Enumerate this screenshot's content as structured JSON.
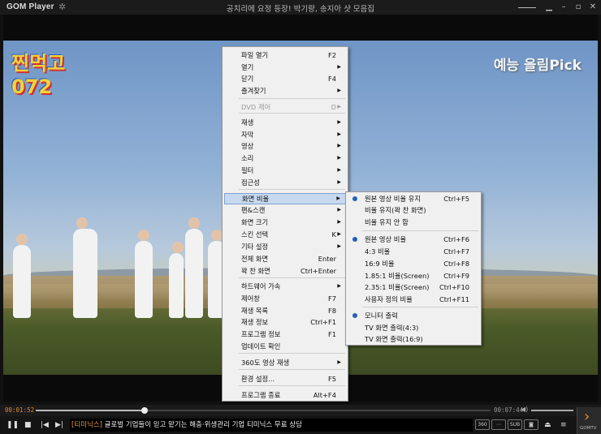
{
  "window": {
    "brand": "GOM Player",
    "title": "공치리에 요정 등장! 박기량, 송지아 샷 모음집"
  },
  "menu": {
    "items": [
      {
        "label": "파일 열기",
        "shortcut": "F2",
        "submenu": false
      },
      {
        "label": "열기",
        "shortcut": "",
        "submenu": true
      },
      {
        "label": "닫기",
        "shortcut": "F4",
        "submenu": false
      },
      {
        "label": "즐겨찾기",
        "shortcut": "",
        "submenu": true
      },
      {
        "label": "DVD 제어",
        "shortcut": "D",
        "submenu": true,
        "disabled": true
      },
      {
        "label": "재생",
        "shortcut": "",
        "submenu": true
      },
      {
        "label": "자막",
        "shortcut": "",
        "submenu": true
      },
      {
        "label": "영상",
        "shortcut": "",
        "submenu": true
      },
      {
        "label": "소리",
        "shortcut": "",
        "submenu": true
      },
      {
        "label": "필터",
        "shortcut": "",
        "submenu": true
      },
      {
        "label": "접근성",
        "shortcut": "",
        "submenu": true
      },
      {
        "label": "화면 비율",
        "shortcut": "",
        "submenu": true,
        "highlighted": true
      },
      {
        "label": "팬&스캔",
        "shortcut": "",
        "submenu": true
      },
      {
        "label": "화면 크기",
        "shortcut": "",
        "submenu": true
      },
      {
        "label": "스킨 선택",
        "shortcut": "K",
        "submenu": true
      },
      {
        "label": "기타 설정",
        "shortcut": "",
        "submenu": true
      },
      {
        "label": "전체 화면",
        "shortcut": "Enter",
        "submenu": false
      },
      {
        "label": "꽉 찬 화면",
        "shortcut": "Ctrl+Enter",
        "submenu": false
      },
      {
        "label": "하드웨어 가속",
        "shortcut": "",
        "submenu": true
      },
      {
        "label": "제어창",
        "shortcut": "F7",
        "submenu": false
      },
      {
        "label": "재생 목록",
        "shortcut": "F8",
        "submenu": false
      },
      {
        "label": "재생 정보",
        "shortcut": "Ctrl+F1",
        "submenu": false
      },
      {
        "label": "프로그램 정보",
        "shortcut": "F1",
        "submenu": false
      },
      {
        "label": "업데이트 확인",
        "shortcut": "",
        "submenu": false
      },
      {
        "label": "360도 영상 재생",
        "shortcut": "",
        "submenu": true
      },
      {
        "label": "환경 설정...",
        "shortcut": "F5",
        "submenu": false
      },
      {
        "label": "프로그램 종료",
        "shortcut": "Alt+F4",
        "submenu": false
      }
    ]
  },
  "submenu": {
    "items": [
      {
        "label": "원본 영상 비율 유지",
        "shortcut": "Ctrl+F5",
        "checked": true
      },
      {
        "label": "비율 유지(꽉 찬 화면)",
        "shortcut": "",
        "checked": false
      },
      {
        "label": "비율 유지 안 함",
        "shortcut": "",
        "checked": false
      },
      {
        "label": "원본 영상 비율",
        "shortcut": "Ctrl+F6",
        "checked": true
      },
      {
        "label": "4:3 비율",
        "shortcut": "Ctrl+F7",
        "checked": false
      },
      {
        "label": "16:9 비율",
        "shortcut": "Ctrl+F8",
        "checked": false
      },
      {
        "label": "1.85:1 비율(Screen)",
        "shortcut": "Ctrl+F9",
        "checked": false
      },
      {
        "label": "2.35:1 비율(Screen)",
        "shortcut": "Ctrl+F10",
        "checked": false
      },
      {
        "label": "사용자 정의 비율",
        "shortcut": "Ctrl+F11",
        "checked": false
      },
      {
        "label": "모니터 출력",
        "shortcut": "",
        "checked": true
      },
      {
        "label": "TV 화면 출력(4:3)",
        "shortcut": "",
        "checked": false
      },
      {
        "label": "TV 화면 출력(16:9)",
        "shortcut": "",
        "checked": false
      }
    ]
  },
  "player": {
    "current_time": "00:01:52",
    "total_time": "00:07:44",
    "progress": 0.24,
    "ticker_tag": "[티미닉스]",
    "ticker_text": "글로벌 기업들이 믿고 맡기는 해충·위생관리 기업 티미닉스 무료 상담",
    "gomtv_label": "GOMTV",
    "sub_label": "SUB"
  },
  "video": {
    "logo_left": "찐먹고 072",
    "logo_right": "예능 을림Pick"
  },
  "colors": {
    "accent": "#d88a3c",
    "menu_highlight": "#c8d9ef",
    "radio_dot": "#2560b8"
  }
}
